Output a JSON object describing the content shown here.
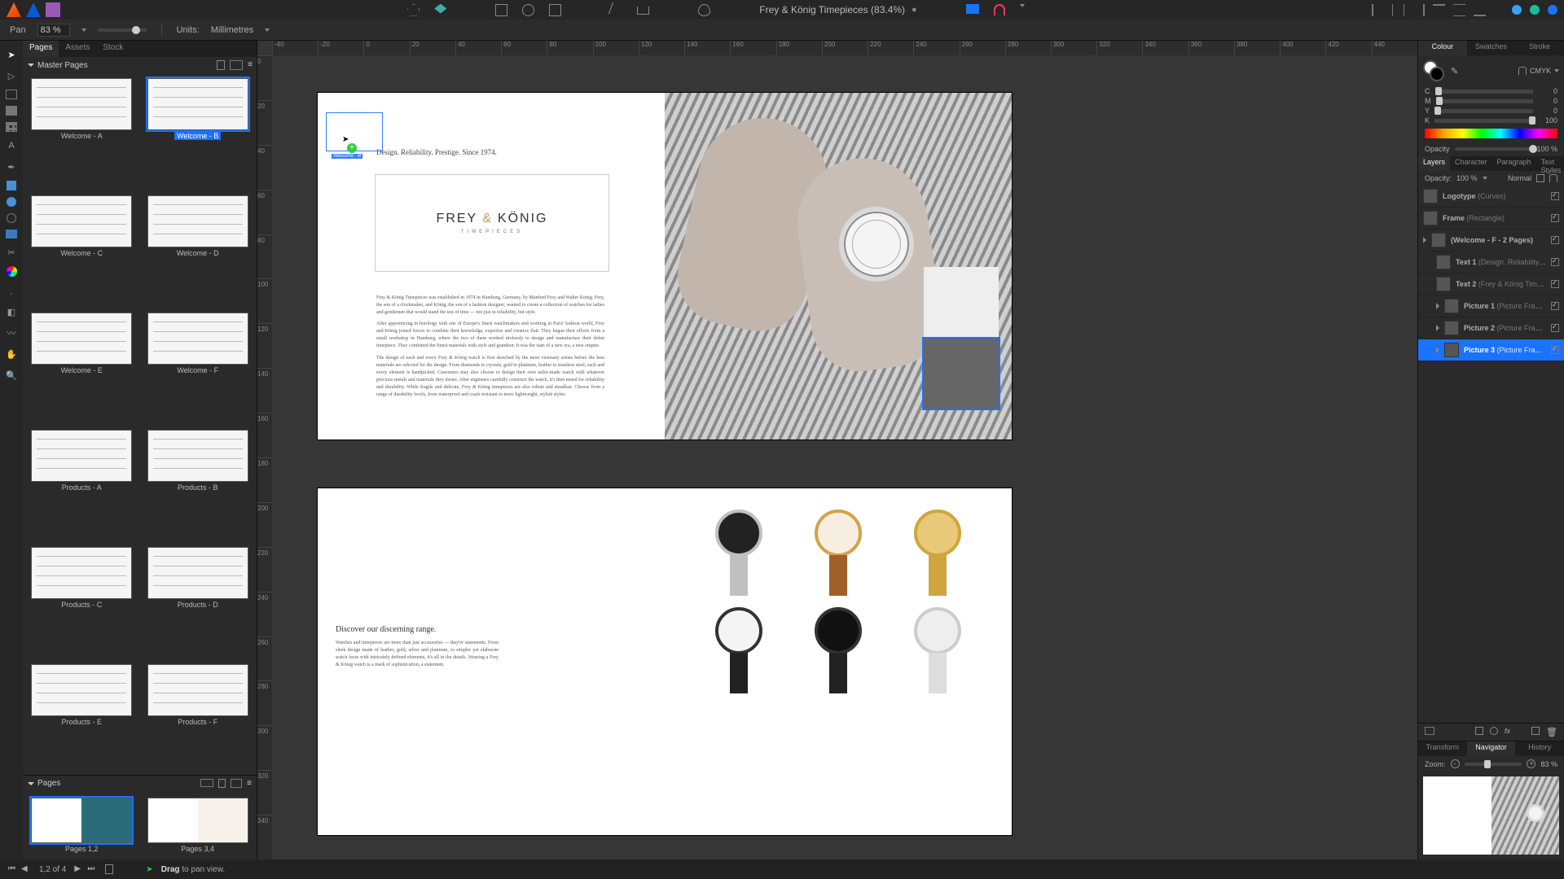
{
  "app": {
    "title": "Frey & König Timepieces (83.4%)",
    "dirty": "●"
  },
  "ctx": {
    "tool_label": "Pan",
    "zoom_field": "83 %",
    "units_label": "Units:",
    "units_value": "Millimetres"
  },
  "left": {
    "tabs": [
      "Pages",
      "Assets",
      "Stock"
    ],
    "master_header": "Master Pages",
    "masters": [
      {
        "label": "Welcome - A"
      },
      {
        "label": "Welcome - B",
        "selected": true
      },
      {
        "label": "Welcome - C"
      },
      {
        "label": "Welcome - D"
      },
      {
        "label": "Welcome - E"
      },
      {
        "label": "Welcome - F"
      },
      {
        "label": "Products - A"
      },
      {
        "label": "Products - B"
      },
      {
        "label": "Products - C"
      },
      {
        "label": "Products - D"
      },
      {
        "label": "Products - E"
      },
      {
        "label": "Products - F"
      }
    ],
    "pages_header": "Pages",
    "spreads": [
      {
        "label": "Pages 1,2",
        "selected": true
      },
      {
        "label": "Pages 3,4"
      }
    ]
  },
  "ruler_h": [
    "-40",
    "-20",
    "0",
    "20",
    "40",
    "60",
    "80",
    "100",
    "120",
    "140",
    "160",
    "180",
    "200",
    "220",
    "240",
    "260",
    "280",
    "300",
    "320",
    "340",
    "360",
    "380",
    "400",
    "420",
    "440"
  ],
  "ruler_v": [
    "0",
    "20",
    "40",
    "60",
    "80",
    "100",
    "120",
    "140",
    "160",
    "180",
    "200",
    "220",
    "240",
    "260",
    "280",
    "300",
    "320",
    "340"
  ],
  "doc": {
    "tagline": "Design. Reliability. Prestige. Since 1974.",
    "brand_a": "FREY",
    "brand_amp": "&",
    "brand_b": "KÖNIG",
    "brand_sub": "TIMEPIECES",
    "para1": "Frey & König Timepieces was established in 1974 in Hamburg, Germany, by Manfred Frey and Walter König. Frey, the son of a clockmaker, and König, the son of a fashion designer, wanted to create a collection of watches for ladies and gentlemen that would stand the test of time — not just in reliability, but style.",
    "para2": "After apprenticing in horology with one of Europe's finest watchmakers and working in Paris' fashion world, Frey and König joined forces to combine their knowledge, expertise and creative flair. They began their efforts from a small workshop in Hamburg, where the two of them worked tirelessly to design and manufacture their debut timepiece. They combined the finest materials with style and grandeur. It was the start of a new era, a new empire.",
    "para3": "The design of each and every Frey & König watch is first sketched by the most visionary artists before the best materials are selected for the design. From diamonds to crystals, gold to platinum, leather to stainless steel, each and every element is handpicked. Customers may also choose to design their own tailor-made watch with whatever precious metals and materials they desire. After engineers carefully construct the watch, it's then tested for reliability and durability. While fragile and delicate, Frey & König timepieces are also robust and steadfast. Choose from a range of durability levels, from waterproof and crack resistant to more lightweight, stylish styles.",
    "discover": "Discover our discerning range.",
    "discover_para": "Watches and timepieces are more than just accessories — they're statements. From sleek design made of leather, gold, silver and platinum, to simpler yet elaborate watch faces with intricately defined elements, it's all in the details. Wearing a Frey & König watch is a mark of sophistication, a statement.",
    "drag_label": "Welcome - B"
  },
  "right": {
    "colour_tabs": [
      "Colour",
      "Swatches",
      "Stroke"
    ],
    "colour_space": "CMYK",
    "cmyk": [
      {
        "ch": "C",
        "val": "0"
      },
      {
        "ch": "M",
        "val": "0"
      },
      {
        "ch": "Y",
        "val": "0"
      },
      {
        "ch": "K",
        "val": "100"
      }
    ],
    "opacity_label": "Opacity",
    "opacity_val": "100 %",
    "layer_tabs": [
      "Layers",
      "Character",
      "Paragraph",
      "Text Styles"
    ],
    "layer_opacity_label": "Opacity:",
    "layer_opacity_val": "100 %",
    "blend_mode": "Normal",
    "layers": [
      {
        "name": "Logotype",
        "type": "(Curves)",
        "chk": true
      },
      {
        "name": "Frame",
        "type": "(Rectangle)",
        "chk": true
      },
      {
        "name": "(Welcome - F - 2 Pages)",
        "type": "",
        "chk": true,
        "group": true
      },
      {
        "name": "Text 1",
        "type": "(Design. Reliability. Pr",
        "chk": true,
        "indent": true
      },
      {
        "name": "Text 2",
        "type": "(Frey & König Timepie",
        "chk": true,
        "indent": true
      },
      {
        "name": "Picture 1",
        "type": "(Picture Frame)",
        "chk": true,
        "indent": true,
        "arrow": true
      },
      {
        "name": "Picture 2",
        "type": "(Picture Frame)",
        "chk": true,
        "indent": true,
        "arrow": true
      },
      {
        "name": "Picture 3",
        "type": "(Picture Frame)",
        "chk": true,
        "indent": true,
        "arrow": true,
        "selected": true
      }
    ],
    "nav_tabs": [
      "Transform",
      "Navigator",
      "History"
    ],
    "zoom_label": "Zoom:",
    "zoom_val": "83 %"
  },
  "status": {
    "page_counter": "1,2 of 4",
    "hint_strong": "Drag",
    "hint_rest": "to pan view."
  }
}
